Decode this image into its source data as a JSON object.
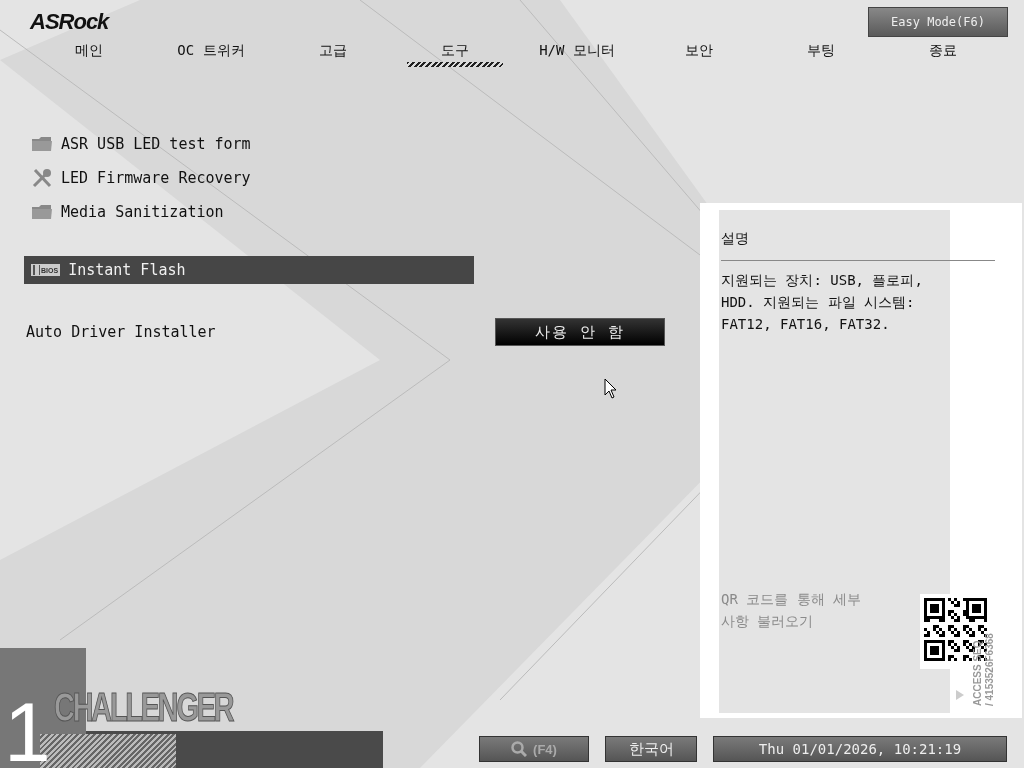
{
  "brand": "ASRock",
  "easy_mode_button": "Easy Mode(F6)",
  "tabs": [
    {
      "label": "메인",
      "selected": false
    },
    {
      "label": "OC 트위커",
      "selected": false
    },
    {
      "label": "고급",
      "selected": false
    },
    {
      "label": "도구",
      "selected": true
    },
    {
      "label": "H/W 모니터",
      "selected": false
    },
    {
      "label": "보안",
      "selected": false
    },
    {
      "label": "부팅",
      "selected": false
    },
    {
      "label": "종료",
      "selected": false
    }
  ],
  "menu": [
    {
      "kind": "folder",
      "label": "ASR USB LED test form",
      "selected": false
    },
    {
      "kind": "tools",
      "label": "LED Firmware Recovery",
      "selected": false
    },
    {
      "kind": "folder",
      "label": "Media Sanitization",
      "selected": false
    },
    {
      "kind": "bios",
      "label": "Instant Flash",
      "icon_text": "BIOS",
      "selected": true
    }
  ],
  "settings": [
    {
      "label": "Auto Driver Installer",
      "value": "사용 안 함"
    }
  ],
  "help": {
    "title": "설명",
    "text": "지원되는 장치: USB, 플로피, HDD. 지원되는 파일 시스템: FAT12, FAT16, FAT32.",
    "qr_hint": "QR 코드를 통해 세부 사항 불러오기",
    "access_label": "ACCESS SEQ",
    "access_code": "/ 4153526F6368"
  },
  "badge": {
    "number": "1",
    "word": "CHALLENGER"
  },
  "bottom": {
    "search_key": "(F4)",
    "language": "한국어",
    "datetime": "Thu 01/01/2026, 10:21:19"
  }
}
